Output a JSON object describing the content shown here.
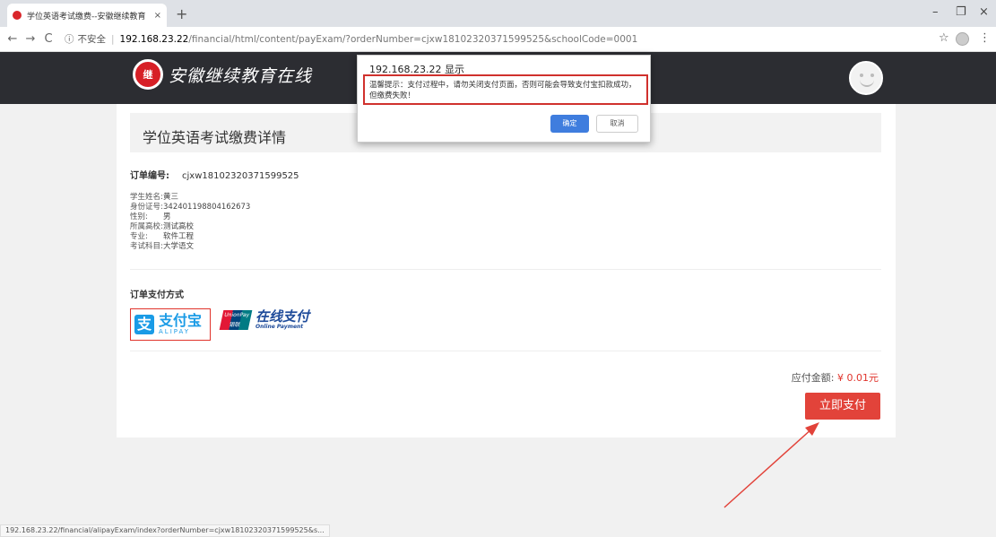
{
  "browser": {
    "tab_title": "学位英语考试缴费--安徽继续教育",
    "tab_close": "×",
    "new_tab": "+",
    "window_controls": {
      "minimize": "–",
      "restore": "❐",
      "close": "×"
    },
    "nav": {
      "back": "←",
      "forward": "→",
      "reload": "C"
    },
    "address": {
      "info_icon": "ⓘ",
      "insecure_label": "不安全",
      "separator": "|",
      "host": "192.168.23.22",
      "path": "/financial/html/content/payExam/?orderNumber=cjxw18102320371599525&schoolCode=0001"
    },
    "star": "☆",
    "menu": "⋮",
    "status_url": "192.168.23.22/financial/alipayExam/index?orderNumber=cjxw18102320371599525&s..."
  },
  "site": {
    "logo_text": "安徽继续教育在线",
    "logo_mark": "继"
  },
  "page": {
    "title": "学位英语考试缴费详情",
    "order_label": "订单编号:",
    "order_number": "cjxw18102320371599525",
    "info": [
      {
        "key": "学生姓名:",
        "value": "黄三"
      },
      {
        "key": "身份证号:",
        "value": "342401198804162673"
      },
      {
        "key": "性别:",
        "value": "男"
      },
      {
        "key": "所属高校:",
        "value": "测试高校"
      },
      {
        "key": "专业:",
        "value": "软件工程"
      },
      {
        "key": "考试科目:",
        "value": "大学语文"
      }
    ],
    "pay_method_title": "订单支付方式",
    "alipay": {
      "glyph": "支",
      "cn": "支付宝",
      "en": "ALIPAY"
    },
    "unionpay": {
      "badge_top": "UnionPay",
      "badge_bottom": "银联",
      "cn": "在线支付",
      "en": "Online Payment"
    },
    "amount_label": "应付金额:",
    "amount_value": "¥ 0.01元",
    "pay_button": "立即支付"
  },
  "dialog": {
    "title": "192.168.23.22 显示",
    "message": "温馨提示：支付过程中，请勿关闭支付页面，否则可能会导致支付宝扣款成功，但缴费失败！",
    "ok": "确定",
    "cancel": "取消"
  },
  "colors": {
    "header_bg": "#2c2d32",
    "accent_red": "#e2433a",
    "ok_blue": "#3f7dde",
    "highlight_red": "#d0312d"
  }
}
